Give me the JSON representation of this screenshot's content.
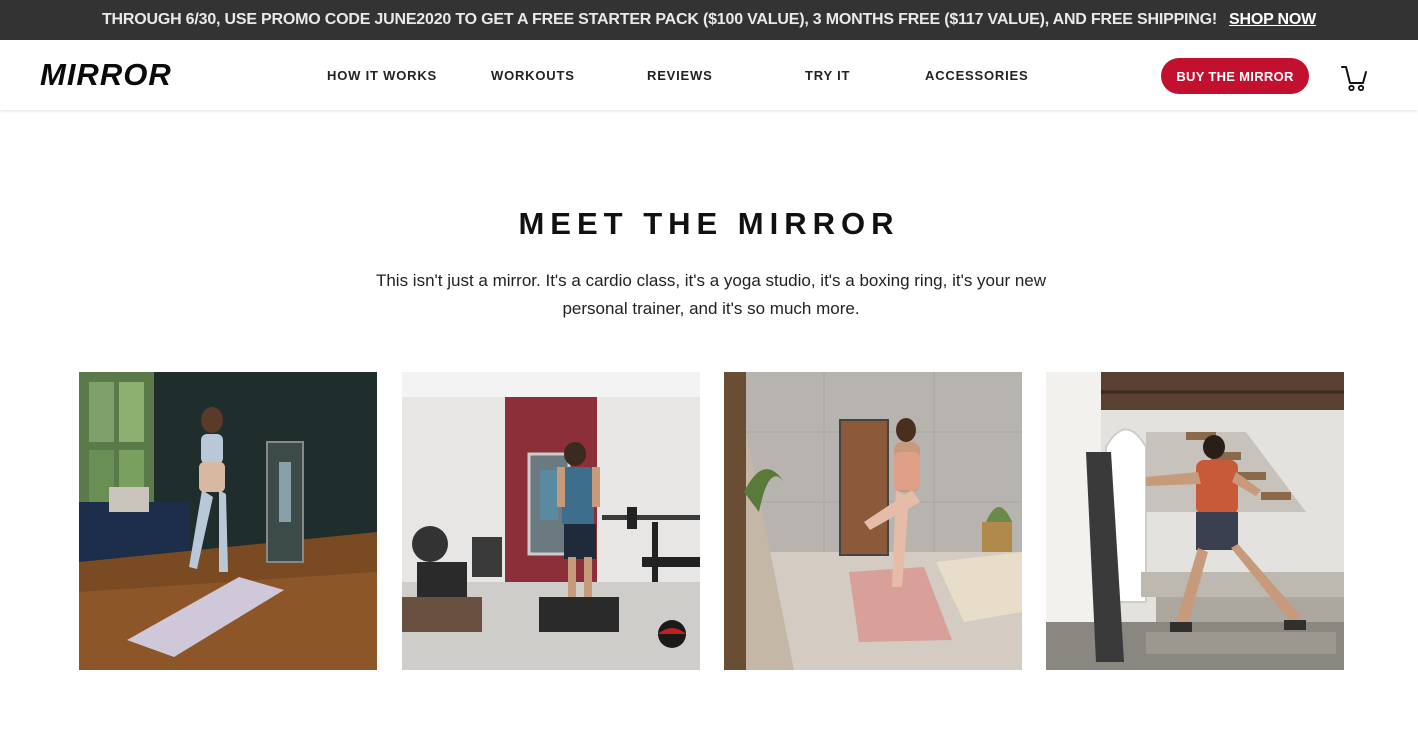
{
  "promo": {
    "text": "THROUGH 6/30, USE PROMO CODE JUNE2020 TO GET A FREE STARTER PACK ($100 VALUE), 3 MONTHS FREE ($117 VALUE), AND FREE SHIPPING!",
    "link": "SHOP NOW"
  },
  "header": {
    "logo": "MIRROR",
    "nav": [
      "HOW IT WORKS",
      "WORKOUTS",
      "REVIEWS",
      "TRY IT",
      "ACCESSORIES"
    ],
    "buy_button": "BUY THE MIRROR",
    "cart_icon": "cart-icon"
  },
  "main": {
    "title": "MEET THE MIRROR",
    "description": "This isn't just a mirror. It's a cardio class, it's a yoga studio, it's a boxing ring, it's your new personal trainer, and it's so much more.",
    "photos": [
      "yoga-living-room",
      "weights-home-gym",
      "yoga-balance-studio",
      "boxing-loft"
    ]
  },
  "colors": {
    "promo_bg": "#333333",
    "accent": "#c4102f",
    "text": "#111111"
  }
}
